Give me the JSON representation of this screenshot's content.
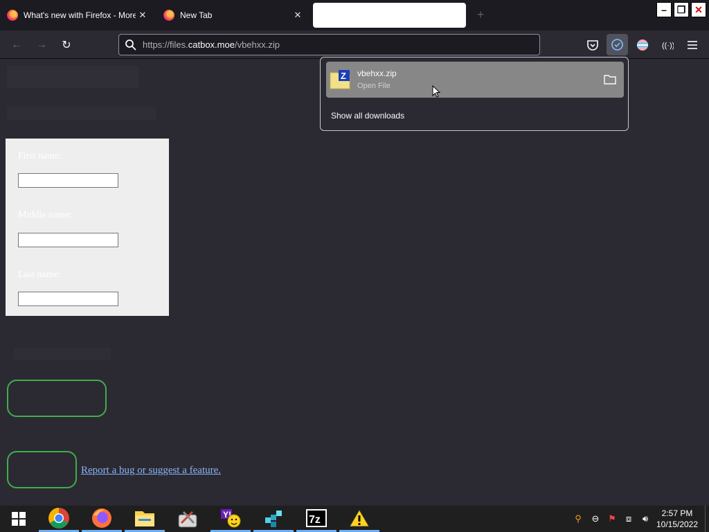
{
  "tabs": [
    {
      "title": "What's new with Firefox - More",
      "close": "✕"
    },
    {
      "title": "New Tab",
      "close": "✕"
    },
    {
      "title": ""
    }
  ],
  "new_tab_symbol": "+",
  "window_controls": {
    "minimize": "–",
    "restore": "❐",
    "close": "✕"
  },
  "nav": {
    "back_symbol": "←",
    "forward_symbol": "→",
    "reload_symbol": "↻",
    "url_prefix": "https://files.",
    "url_domain": "catbox.moe",
    "url_path": "/vbehxx.zip"
  },
  "page": {
    "form": {
      "first_name_label": "First name:",
      "first_name_value": "",
      "middle_name_label": "Middle name:",
      "middle_name_value": "",
      "last_name_label": "Last name:",
      "last_name_value": ""
    },
    "bug_link": "Report a bug or suggest a feature."
  },
  "downloads": {
    "file_name": "vbehxx.zip",
    "status": "Open File",
    "show_all": "Show all downloads"
  },
  "clock": {
    "time": "2:57 PM",
    "date": "10/15/2022"
  },
  "colors": {
    "accent": "#6ab0f3",
    "page_bg": "#2b2a33",
    "button_border": "#3fae4a",
    "link": "#8ab4f8"
  }
}
